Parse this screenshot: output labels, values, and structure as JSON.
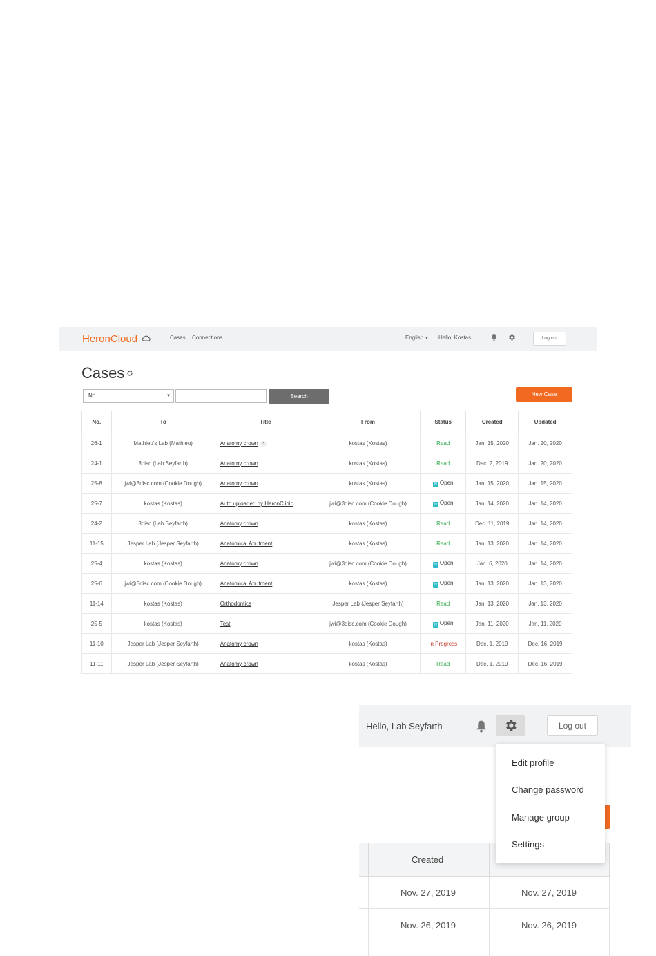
{
  "navbar": {
    "brand_part1": "Heron",
    "brand_part2": "Cloud",
    "links": [
      "Cases",
      "Connections"
    ],
    "language": "English",
    "greeting": "Hello, Kostas",
    "logout": "Log out"
  },
  "page": {
    "title": "Cases",
    "filter_select": "No.",
    "search_value": "",
    "search_button": "Search",
    "new_case_button": "New Case"
  },
  "table": {
    "headers": [
      "No.",
      "To",
      "Title",
      "From",
      "Status",
      "Created",
      "Updated"
    ],
    "rows": [
      {
        "no": "26-1",
        "to": "Mathieu's Lab (Mathieu)",
        "title": "Anatomy crown",
        "count": "3",
        "from": "kostas (Kostas)",
        "status": "Read",
        "status_type": "read",
        "created": "Jan. 15, 2020",
        "updated": "Jan. 20, 2020"
      },
      {
        "no": "24-1",
        "to": "3disc (Lab Seyfarth)",
        "title": "Anatomy crown",
        "count": "",
        "from": "kostas (Kostas)",
        "status": "Read",
        "status_type": "read",
        "created": "Dec. 2, 2019",
        "updated": "Jan. 20, 2020"
      },
      {
        "no": "25-8",
        "to": "jwi@3disc.com (Cookie Dough)",
        "title": "Anatomy crown",
        "count": "",
        "from": "kostas (Kostas)",
        "status": "Open",
        "status_type": "open",
        "created": "Jan. 15, 2020",
        "updated": "Jan. 15, 2020"
      },
      {
        "no": "25-7",
        "to": "kostas (Kostas)",
        "title": "Auto uploaded by HeronClinic",
        "count": "",
        "from": "jwi@3disc.com (Cookie Dough)",
        "status": "Open",
        "status_type": "open",
        "created": "Jan. 14, 2020",
        "updated": "Jan. 14, 2020"
      },
      {
        "no": "24-2",
        "to": "3disc (Lab Seyfarth)",
        "title": "Anatomy crown",
        "count": "",
        "from": "kostas (Kostas)",
        "status": "Read",
        "status_type": "read",
        "created": "Dec. 11, 2019",
        "updated": "Jan. 14, 2020"
      },
      {
        "no": "11-15",
        "to": "Jesper Lab (Jesper Seyfarth)",
        "title": "Anatomical Abutment",
        "count": "",
        "from": "kostas (Kostas)",
        "status": "Read",
        "status_type": "read",
        "created": "Jan. 13, 2020",
        "updated": "Jan. 14, 2020"
      },
      {
        "no": "25-4",
        "to": "kostas (Kostas)",
        "title": "Anatomy crown",
        "count": "",
        "from": "jwi@3disc.com (Cookie Dough)",
        "status": "Open",
        "status_type": "open",
        "created": "Jan. 6, 2020",
        "updated": "Jan. 14, 2020"
      },
      {
        "no": "25-6",
        "to": "jwi@3disc.com (Cookie Dough)",
        "title": "Anatomical Abutment",
        "count": "",
        "from": "kostas (Kostas)",
        "status": "Open",
        "status_type": "open",
        "created": "Jan. 13, 2020",
        "updated": "Jan. 13, 2020"
      },
      {
        "no": "11-14",
        "to": "kostas (Kostas)",
        "title": "Orthodontics",
        "count": "",
        "from": "Jesper Lab (Jesper Seyfarth)",
        "status": "Read",
        "status_type": "read",
        "created": "Jan. 13, 2020",
        "updated": "Jan. 13, 2020"
      },
      {
        "no": "25-5",
        "to": "kostas (Kostas)",
        "title": "Test",
        "count": "",
        "from": "jwi@3disc.com (Cookie Dough)",
        "status": "Open",
        "status_type": "open",
        "created": "Jan. 11, 2020",
        "updated": "Jan. 11, 2020"
      },
      {
        "no": "11-10",
        "to": "Jesper Lab (Jesper Seyfarth)",
        "title": "Anatomy crown",
        "count": "",
        "from": "kostas (Kostas)",
        "status": "In Progress",
        "status_type": "progress",
        "created": "Dec. 1, 2019",
        "updated": "Dec. 16, 2019"
      },
      {
        "no": "11-11",
        "to": "Jesper Lab (Jesper Seyfarth)",
        "title": "Anatomy crown",
        "count": "",
        "from": "kostas (Kostas)",
        "status": "Read",
        "status_type": "read",
        "created": "Dec. 1, 2019",
        "updated": "Dec. 16, 2019"
      }
    ]
  },
  "zoom": {
    "greeting": "Hello, Lab Seyfarth",
    "logout": "Log out",
    "menu": [
      "Edit profile",
      "Change password",
      "Manage group",
      "Settings"
    ],
    "header_created": "Created",
    "rows": [
      {
        "created": "Nov. 27, 2019",
        "updated": "Nov. 27, 2019"
      },
      {
        "created": "Nov. 26, 2019",
        "updated": "Nov. 26, 2019"
      }
    ]
  },
  "colors": {
    "brand": "#f26a21",
    "read": "#2ea84a",
    "open_badge": "#2fbac9",
    "in_progress": "#c0392b",
    "search_button": "#6d6d6d"
  }
}
